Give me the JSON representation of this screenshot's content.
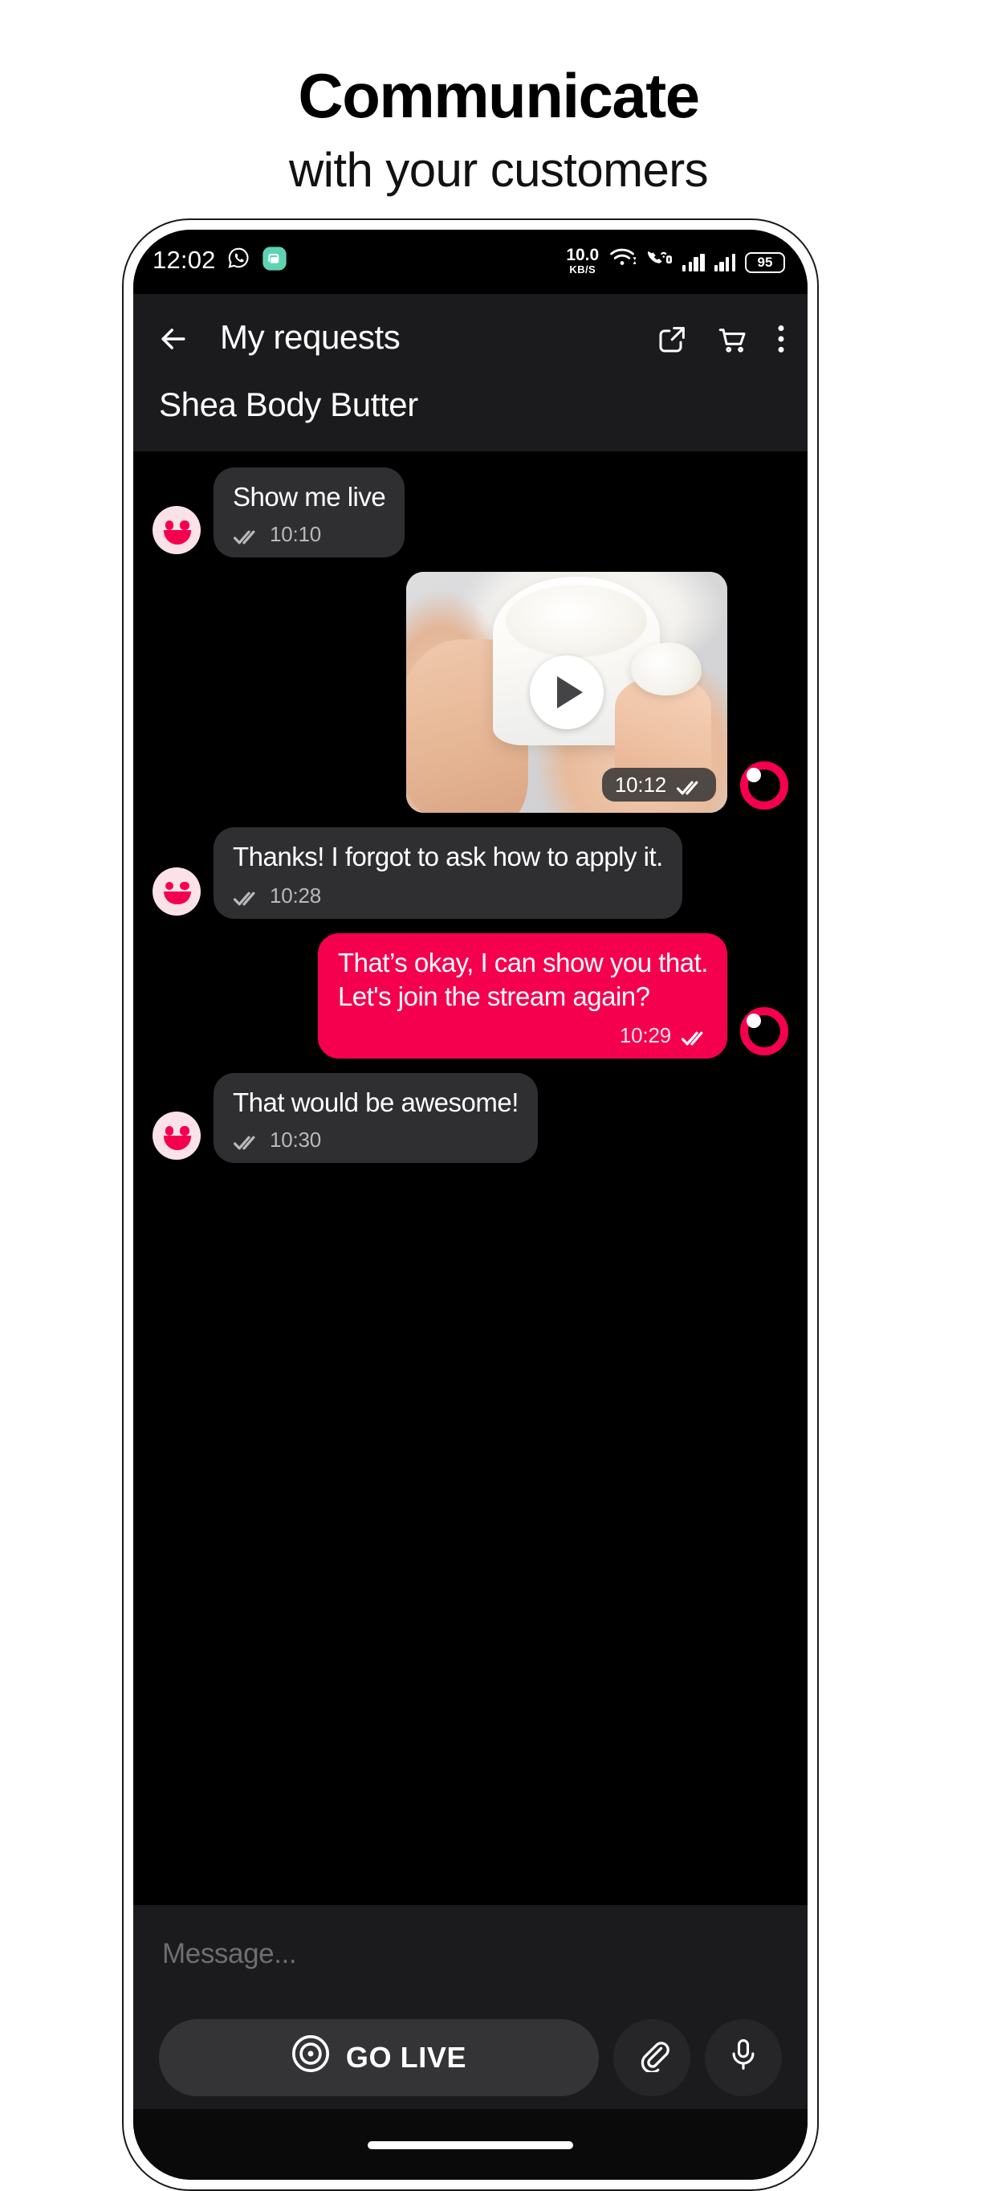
{
  "promo": {
    "title": "Communicate",
    "subtitle": "with your customers"
  },
  "status_bar": {
    "time": "12:02",
    "whatsapp_icon": "whatsapp-icon",
    "messenger_icon": "messenger-icon",
    "network_speed_value": "10.0",
    "network_speed_unit": "KB/S",
    "wifi_icon": "wifi-icon",
    "call_icon": "missed-call-icon",
    "signal_1_icon": "signal-bars-icon",
    "signal_2_icon": "signal-bars-icon",
    "battery_level": "95"
  },
  "header": {
    "back_icon": "arrow-left-icon",
    "title": "My requests",
    "share_icon": "share-external-icon",
    "cart_icon": "shopping-cart-icon",
    "more_icon": "more-vertical-icon",
    "subtitle": "Shea Body Butter"
  },
  "chat": {
    "messages": [
      {
        "id": "m1",
        "direction": "in",
        "type": "text",
        "text": "Show me live",
        "time": "10:10",
        "status_icon": "double-check-icon",
        "avatar": "smiley-avatar"
      },
      {
        "id": "m2",
        "direction": "out",
        "type": "video",
        "text": "",
        "time": "10:12",
        "status_icon": "double-check-icon",
        "avatar": "live-ring-avatar",
        "play_icon": "play-icon"
      },
      {
        "id": "m3",
        "direction": "in",
        "type": "text",
        "text": "Thanks! I forgot to ask how to apply it.",
        "time": "10:28",
        "status_icon": "double-check-icon",
        "avatar": "smiley-avatar"
      },
      {
        "id": "m4",
        "direction": "out",
        "type": "text",
        "text": "That’s okay, I can show you that. Let's join the stream again?",
        "text_line_1": "That’s okay, I can show you that.",
        "text_line_2": "Let's join the stream again?",
        "time": "10:29",
        "status_icon": "double-check-icon",
        "avatar": "live-ring-avatar"
      },
      {
        "id": "m5",
        "direction": "in",
        "type": "text",
        "text": "That would be awesome!",
        "time": "10:30",
        "status_icon": "double-check-icon",
        "avatar": "smiley-avatar"
      }
    ]
  },
  "composer": {
    "message_placeholder": "Message...",
    "message_value": "",
    "go_live_label": "GO LIVE",
    "go_live_icon": "broadcast-target-icon",
    "attach_icon": "paperclip-icon",
    "mic_icon": "microphone-icon"
  },
  "colors": {
    "accent": "#F5004F",
    "bubble_incoming": "#2F2F31",
    "header_bg": "#1B1B1D",
    "chat_bg": "#000000",
    "go_live_bg": "#343436"
  }
}
